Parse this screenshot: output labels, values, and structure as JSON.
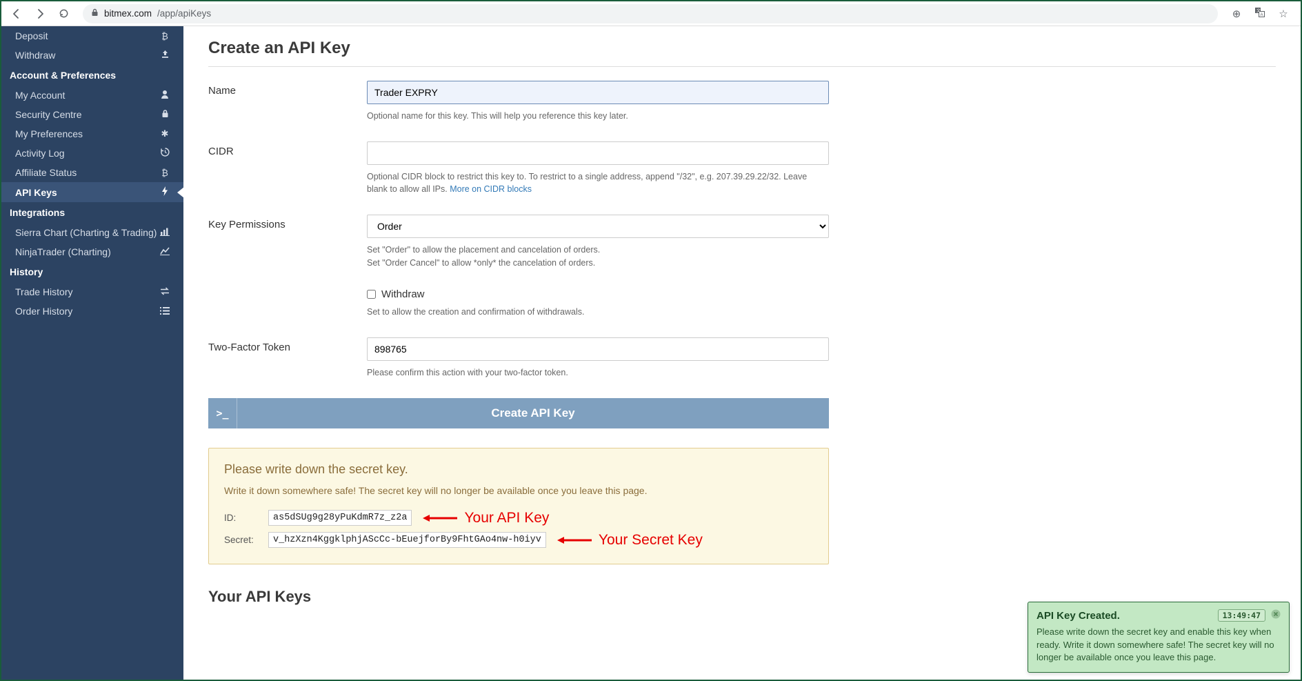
{
  "browser": {
    "url_host": "bitmex.com",
    "url_path": "/app/apiKeys"
  },
  "sidebar": {
    "top_items": [
      {
        "label": "Deposit",
        "icon": "₿"
      },
      {
        "label": "Withdraw",
        "icon": "⬆"
      }
    ],
    "sections": [
      {
        "title": "Account & Preferences",
        "items": [
          {
            "label": "My Account",
            "icon": "user"
          },
          {
            "label": "Security Centre",
            "icon": "lock"
          },
          {
            "label": "My Preferences",
            "icon": "gear"
          },
          {
            "label": "Activity Log",
            "icon": "history"
          },
          {
            "label": "Affiliate Status",
            "icon": "₿"
          },
          {
            "label": "API Keys",
            "icon": "bolt",
            "active": true
          }
        ]
      },
      {
        "title": "Integrations",
        "items": [
          {
            "label": "Sierra Chart (Charting & Trading)",
            "icon": "bar-chart"
          },
          {
            "label": "NinjaTrader (Charting)",
            "icon": "line-chart"
          }
        ]
      },
      {
        "title": "History",
        "items": [
          {
            "label": "Trade History",
            "icon": "exchange"
          },
          {
            "label": "Order History",
            "icon": "list"
          }
        ]
      }
    ]
  },
  "page": {
    "title": "Create an API Key",
    "name_label": "Name",
    "name_value": "Trader EXPRY",
    "name_help": "Optional name for this key. This will help you reference this key later.",
    "cidr_label": "CIDR",
    "cidr_value": "",
    "cidr_help_1": "Optional CIDR block to restrict this key to. To restrict to a single address, append \"/32\", e.g. 207.39.29.22/32. Leave blank to allow all IPs. ",
    "cidr_link": "More on CIDR blocks",
    "perm_label": "Key Permissions",
    "perm_value": "Order",
    "perm_help_1": "Set \"Order\" to allow the placement and cancelation of orders.",
    "perm_help_2": "Set \"Order Cancel\" to allow *only* the cancelation of orders.",
    "withdraw_label": "Withdraw",
    "withdraw_help": "Set to allow the creation and confirmation of withdrawals.",
    "tfa_label": "Two-Factor Token",
    "tfa_value": "898765",
    "tfa_help": "Please confirm this action with your two-factor token.",
    "create_button": "Create API Key",
    "notice": {
      "title": "Please write down the secret key.",
      "body": "Write it down somewhere safe! The secret key will no longer be available once you leave this page.",
      "id_label": "ID:",
      "id_value": "as5dSUg9g28yPuKdmR7z_z2a",
      "secret_label": "Secret:",
      "secret_value": "v_hzXzn4KggklphjAScCc-bEuejforBy9FhtGAo4nw-h0iyv"
    },
    "annotations": {
      "api_key": "Your API Key",
      "secret_key": "Your Secret Key"
    },
    "subheading": "Your API Keys"
  },
  "toast": {
    "title": "API Key Created.",
    "time": "13:49:47",
    "body": "Please write down the secret key and enable this key when ready. Write it down somewhere safe! The secret key will no longer be available once you leave this page."
  }
}
